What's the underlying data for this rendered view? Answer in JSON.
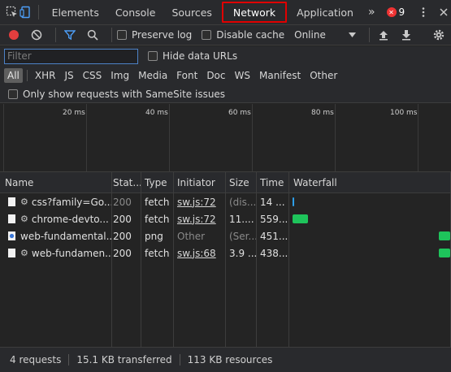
{
  "tabs": {
    "items": [
      "Elements",
      "Console",
      "Sources",
      "Network",
      "Application"
    ],
    "more": "»",
    "error_count": "9"
  },
  "toolbar": {
    "preserve_log": "Preserve log",
    "disable_cache": "Disable cache",
    "throttling": "Online"
  },
  "filter": {
    "placeholder": "Filter",
    "hide_data_urls": "Hide data URLs"
  },
  "types": [
    "All",
    "XHR",
    "JS",
    "CSS",
    "Img",
    "Media",
    "Font",
    "Doc",
    "WS",
    "Manifest",
    "Other"
  ],
  "samesite": "Only show requests with SameSite issues",
  "overview": {
    "ticks": [
      "20 ms",
      "40 ms",
      "60 ms",
      "80 ms",
      "100 ms"
    ]
  },
  "columns": [
    "Name",
    "Stat...",
    "Type",
    "Initiator",
    "Size",
    "Time",
    "Waterfall"
  ],
  "rows": [
    {
      "name": "css?family=Go...",
      "status": "200",
      "type": "fetch",
      "initiator": "sw.js:72",
      "size": "(dis...",
      "time": "14 ...",
      "icon": "gear-doc"
    },
    {
      "name": "chrome-devto...",
      "status": "200",
      "type": "fetch",
      "initiator": "sw.js:72",
      "size": "11....",
      "time": "559...",
      "icon": "gear-doc"
    },
    {
      "name": "web-fundamental...",
      "status": "200",
      "type": "png",
      "initiator": "Other",
      "size": "(Ser...",
      "time": "451...",
      "icon": "image"
    },
    {
      "name": "web-fundamen...",
      "status": "200",
      "type": "fetch",
      "initiator": "sw.js:68",
      "size": "3.9 ...",
      "time": "438...",
      "icon": "gear-doc"
    }
  ],
  "status": {
    "requests": "4 requests",
    "transferred": "15.1 KB transferred",
    "resources": "113 KB resources"
  },
  "colors": {
    "accent": "#4d82c7",
    "record": "#e33e3e",
    "waterfall_green": "#1ec45b",
    "waterfall_blue": "#2d9ee8",
    "highlight": "#e00000"
  }
}
